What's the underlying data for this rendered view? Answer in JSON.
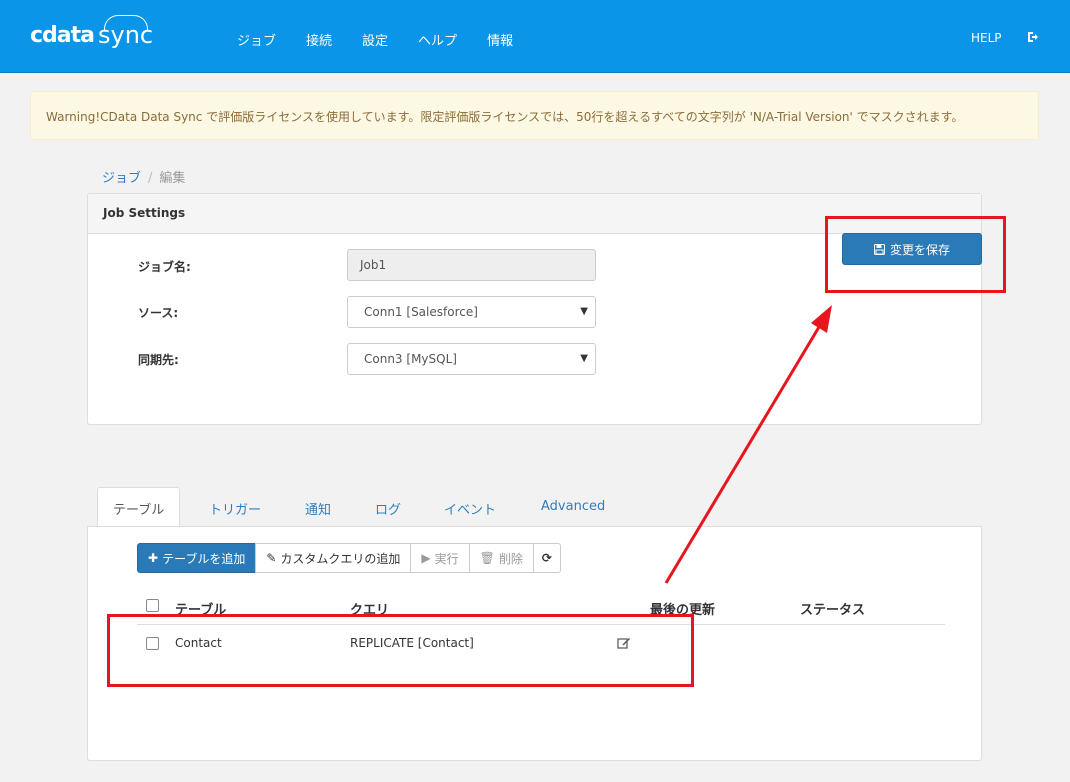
{
  "app": {
    "logo_text_a": "cdata",
    "logo_text_b": "sync",
    "nav": [
      "ジョブ",
      "接続",
      "設定",
      "ヘルプ",
      "情報"
    ],
    "help_label": "HELP",
    "logout_icon": "sign-out-icon"
  },
  "alert": {
    "text": "Warning!CData Data Sync で評価版ライセンスを使用しています。限定評価版ライセンスでは、50行を超えるすべての文字列が 'N/A-Trial Version' でマスクされます。"
  },
  "breadcrumb": {
    "parent": "ジョブ",
    "separator": "/",
    "current": "編集"
  },
  "job_settings": {
    "title": "Job Settings",
    "job_name_label": "ジョブ名:",
    "job_name_value": "Job1",
    "source_label": "ソース:",
    "source_value": "Conn1 [Salesforce]",
    "dest_label": "同期先:",
    "dest_value": "Conn3 [MySQL]",
    "save_label": "変更を保存",
    "save_icon": "floppy-disk-icon"
  },
  "tabs": [
    "テーブル",
    "トリガー",
    "通知",
    "ログ",
    "イベント",
    "Advanced"
  ],
  "active_tab": "テーブル",
  "toolbar": {
    "add_table": "テーブルを追加",
    "custom_query": "カスタムクエリの追加",
    "run": "実行",
    "delete": "削除"
  },
  "table": {
    "columns": [
      "テーブル",
      "クエリ",
      "最後の更新",
      "ステータス"
    ],
    "rows": [
      {
        "table": "Contact",
        "query": "REPLICATE [Contact]",
        "last_update": "",
        "status": ""
      }
    ]
  },
  "colors": {
    "topbar": "#0a95e8",
    "primary_button": "#2a7ab8",
    "annotation": "#e8151c",
    "alert_bg": "#fcf8e3",
    "alert_text": "#8a6d3b"
  }
}
